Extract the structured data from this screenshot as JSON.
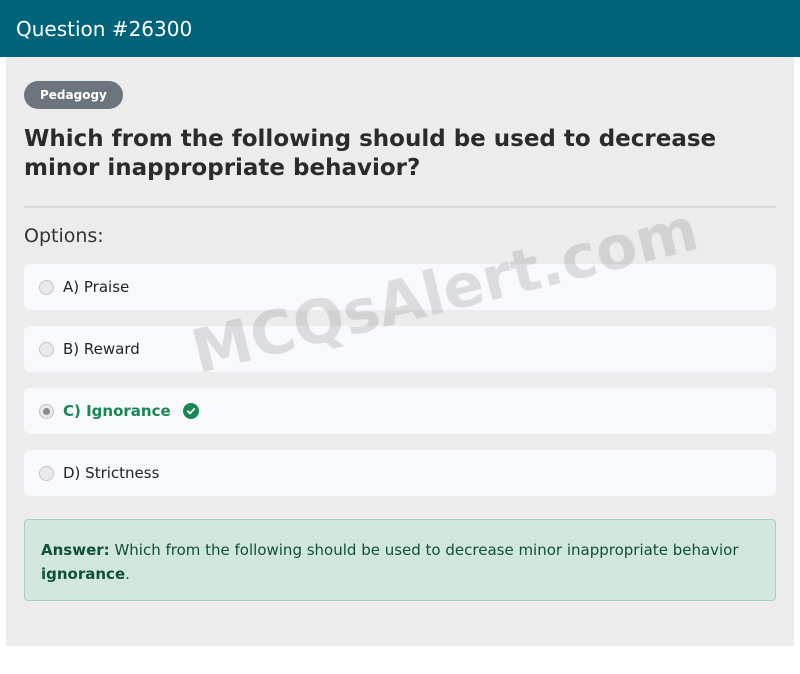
{
  "header": {
    "title": "Question #26300"
  },
  "category": "Pedagogy",
  "question": "Which from the following should be used to decrease minor inappropriate behavior?",
  "options_label": "Options:",
  "options": [
    {
      "label": "A) Praise",
      "selected": false,
      "correct": false
    },
    {
      "label": "B) Reward",
      "selected": false,
      "correct": false
    },
    {
      "label": "C) Ignorance",
      "selected": true,
      "correct": true
    },
    {
      "label": "D) Strictness",
      "selected": false,
      "correct": false
    }
  ],
  "answer": {
    "prefix": "Answer:",
    "text": "Which from the following should be used to decrease minor inappropriate behavior",
    "highlight": "ignorance",
    "suffix": "."
  },
  "watermark": "MCQsAlert.com",
  "colors": {
    "header": "#01637a",
    "correct": "#198754",
    "answer_bg": "#d1e7dd"
  }
}
